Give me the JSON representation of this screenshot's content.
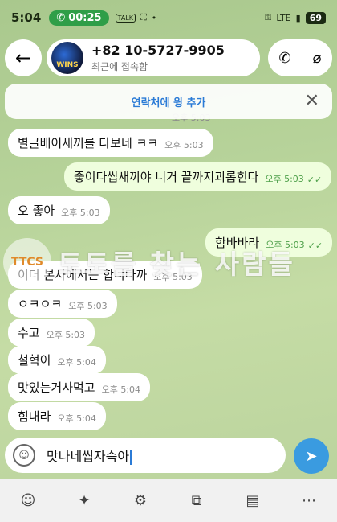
{
  "status_bar": {
    "time": "5:04",
    "call_timer": "00:25",
    "talk_badge": "TALK",
    "battery": "69",
    "network": "LTE"
  },
  "header": {
    "phone": "+82 10-5727-9905",
    "last_seen": "최근에 접속함",
    "avatar_text": "WINS"
  },
  "add_contact": {
    "label": "연락처에 윙 추가"
  },
  "messages": [
    {
      "direction": "in",
      "text": "별글배이새끼를 다보네 ㅋㅋ",
      "time": "오후 5:03"
    },
    {
      "direction": "out",
      "text": "좋이다씹새끼야 너거 끝까지괴롭힌다",
      "time": "오후 5:03",
      "read": true
    },
    {
      "direction": "in",
      "text": "오 좋아",
      "time": "오후 5:03"
    },
    {
      "direction": "out",
      "text": "함바바라",
      "time": "오후 5:03",
      "read": true
    },
    {
      "direction": "in",
      "text": "이더 본사에서는 합니다까",
      "time": "오후 5:03"
    },
    {
      "direction": "in",
      "text": "ㅇㅋㅇㅋ",
      "time": "오후 5:03"
    },
    {
      "direction": "in",
      "text": "수고",
      "time": "오후 5:03"
    },
    {
      "direction": "in",
      "text": "철혁이",
      "time": "오후 5:04"
    },
    {
      "direction": "in",
      "text": "맛있는거사먹고",
      "time": "오후 5:04"
    },
    {
      "direction": "in",
      "text": "힘내라",
      "time": "오후 5:04"
    }
  ],
  "top_partial_time": "오후 5:03",
  "watermark": {
    "logo": "TTCS",
    "text": "토토를 찾는 사람들"
  },
  "composer": {
    "value": "맛나네씹자슥아"
  }
}
